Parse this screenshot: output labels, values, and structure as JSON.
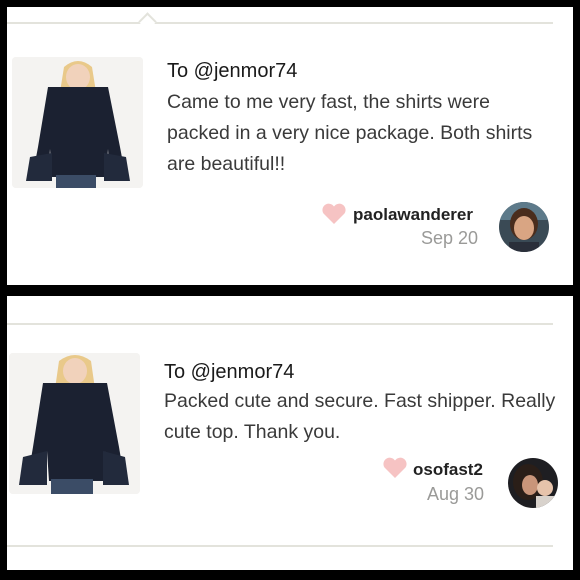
{
  "reviews": [
    {
      "to": "To @jenmor74",
      "message": "Came to me very fast, the shirts were packed in a very nice package. Both shirts are beautiful!!",
      "username": "paolawanderer",
      "date": "Sep 20",
      "icons": {
        "like": "heart-icon",
        "product": "black-bell-sleeve-top-photo",
        "avatar": "user-avatar-photo"
      }
    },
    {
      "to": "To @jenmor74",
      "message": "Packed cute and secure. Fast shipper. Really cute top. Thank you.",
      "username": "osofast2",
      "date": "Aug 30",
      "icons": {
        "like": "heart-icon",
        "product": "black-bell-sleeve-top-photo",
        "avatar": "user-avatar-photo"
      }
    }
  ],
  "colors": {
    "heart": "#f6c3c3",
    "divider": "#e3e3dc",
    "date": "#9a9a98",
    "top": "#1b2131"
  }
}
